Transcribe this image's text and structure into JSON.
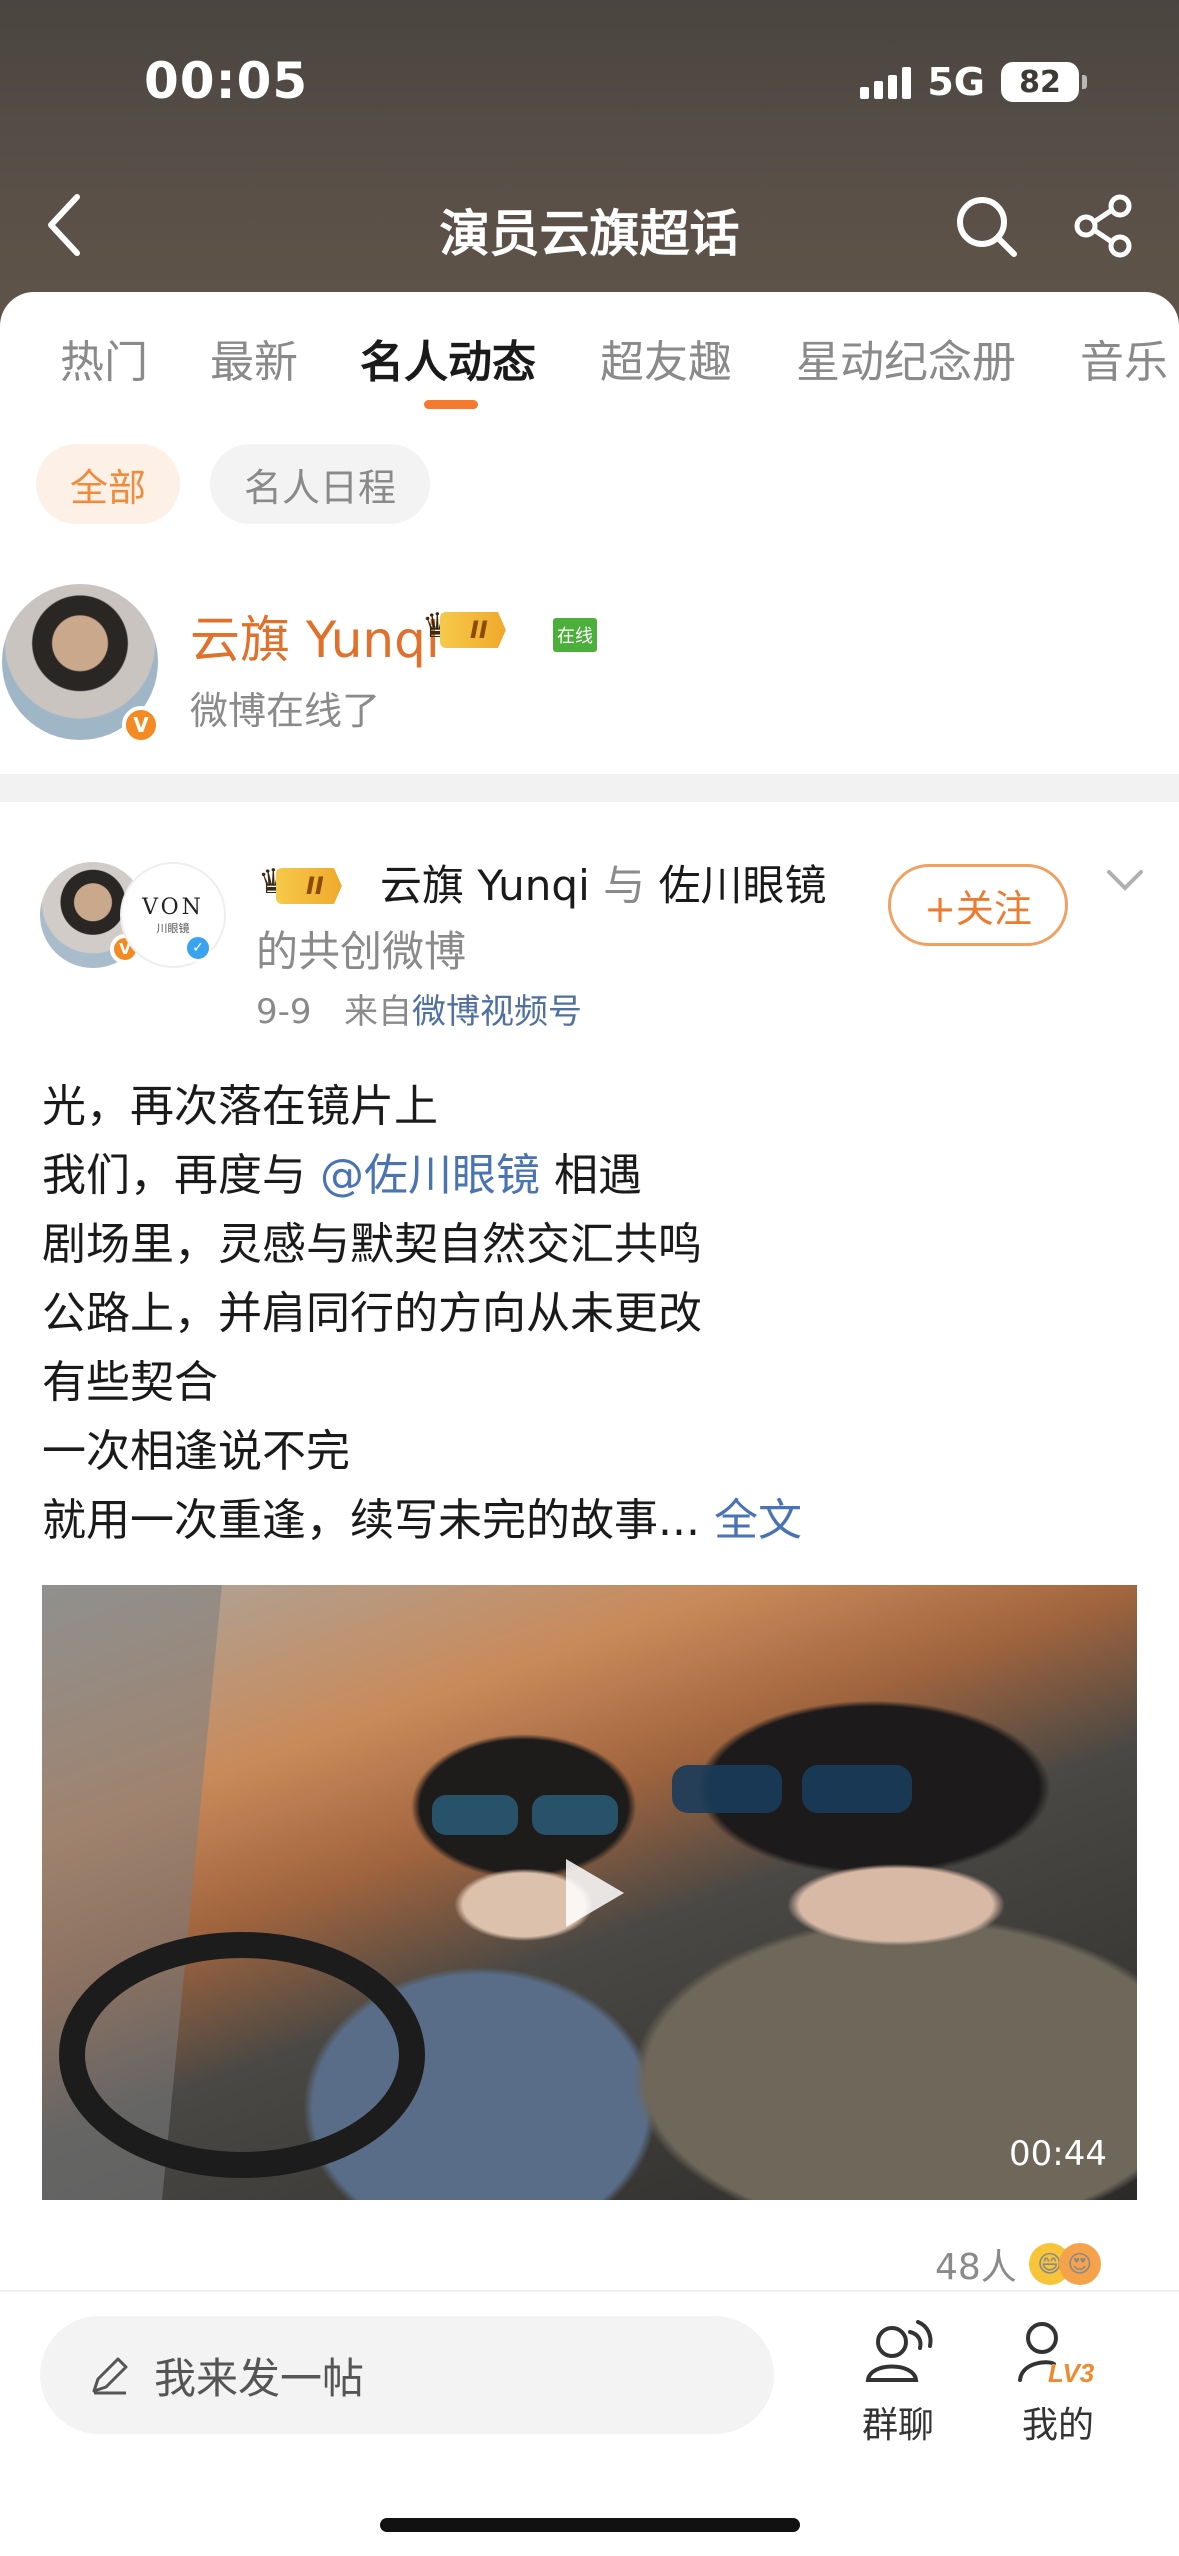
{
  "status_bar": {
    "time": "00:05",
    "network": "5G",
    "battery": "82"
  },
  "header": {
    "title": "演员云旗超话"
  },
  "tabs": [
    {
      "label": "热门"
    },
    {
      "label": "最新"
    },
    {
      "label": "名人动态"
    },
    {
      "label": "超友趣"
    },
    {
      "label": "星动纪念册"
    },
    {
      "label": "音乐"
    }
  ],
  "filters": [
    {
      "label": "全部"
    },
    {
      "label": "名人日程"
    }
  ],
  "online_card": {
    "name": "云旗 Yunqi",
    "level_badge": "II",
    "online_tag": "在线",
    "subtitle": "微博在线了"
  },
  "post": {
    "level_badge": "II",
    "author": "云旗 Yunqi",
    "connector": "与",
    "coauthor": "佐川眼镜",
    "author_suffix": "的共创微博",
    "date": "9-9",
    "source_prefix": "来自",
    "source": "微博视频号",
    "coauthor_logo": "VON",
    "coauthor_logo_sub": "川眼镜",
    "follow_label": "+关注",
    "lines": {
      "l1": "光，再次落在镜片上",
      "l2_a": "我们，再度与 ",
      "l2_mention": "@佐川眼镜",
      "l2_b": " 相遇",
      "l3": "剧场里，灵感与默契自然交汇共鸣",
      "l4": "公路上，并肩同行的方向从未更改",
      "l5": "有些契合",
      "l6": "一次相逢说不完",
      "l7": "就用一次重逢，续写未完的故事...",
      "more": " 全文"
    },
    "video_duration": "00:44",
    "reactions": "48人"
  },
  "bottom_bar": {
    "compose_placeholder": "我来发一帖",
    "group_chat": "群聊",
    "mine": "我的",
    "mine_level": "LV3"
  },
  "colors": {
    "accent": "#f57a2e",
    "link": "#4a73b3",
    "header_bg": "#4a4540"
  }
}
